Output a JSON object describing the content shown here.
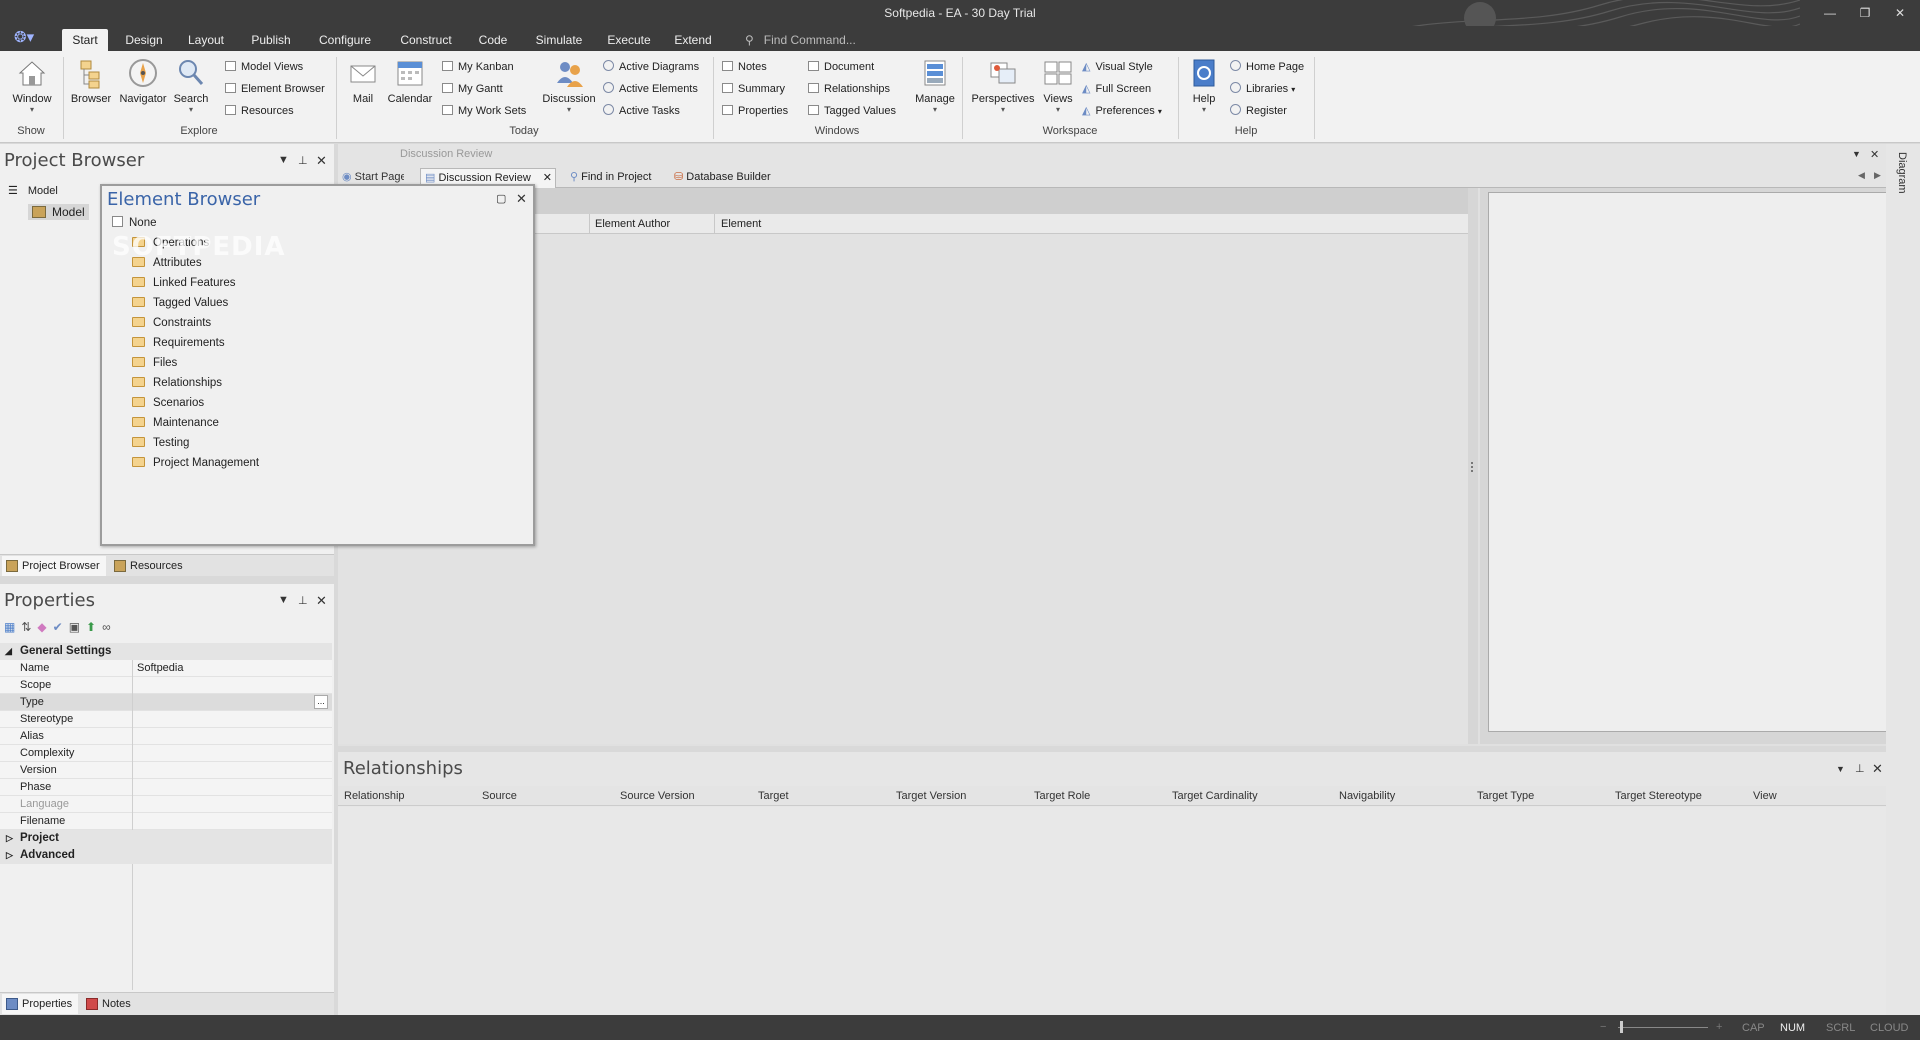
{
  "window": {
    "title": "Softpedia - EA - 30 Day Trial"
  },
  "menu": {
    "tabs": [
      "Start",
      "Design",
      "Layout",
      "Publish",
      "Configure",
      "Construct",
      "Code",
      "Simulate",
      "Execute",
      "Extend"
    ],
    "find_command": "Find Command..."
  },
  "ribbon": {
    "show": {
      "window": "Window",
      "label": "Show"
    },
    "explore": {
      "browser": "Browser",
      "navigator": "Navigator",
      "search": "Search",
      "model_views": "Model Views",
      "element_browser": "Element Browser",
      "resources": "Resources",
      "label": "Explore"
    },
    "today": {
      "mail": "Mail",
      "calendar": "Calendar",
      "my_kanban": "My Kanban",
      "my_gantt": "My Gantt",
      "my_work_sets": "My Work Sets",
      "discussion": "Discussion",
      "active_diagrams": "Active Diagrams",
      "active_elements": "Active Elements",
      "active_tasks": "Active Tasks",
      "label": "Today"
    },
    "windows": {
      "notes": "Notes",
      "summary": "Summary",
      "properties": "Properties",
      "document": "Document",
      "relationships": "Relationships",
      "tagged_values": "Tagged Values",
      "label": "Windows"
    },
    "workspace": {
      "manage": "Manage",
      "perspectives": "Perspectives",
      "views": "Views",
      "visual_style": "Visual Style",
      "full_screen": "Full Screen",
      "preferences": "Preferences",
      "label": "Workspace"
    },
    "help": {
      "help": "Help",
      "home_page": "Home Page",
      "libraries": "Libraries",
      "register": "Register",
      "label": "Help"
    }
  },
  "project_browser": {
    "title": "Project Browser",
    "header": "Model",
    "root": "Model",
    "tabs": [
      "Project Browser",
      "Resources"
    ]
  },
  "element_browser": {
    "title": "Element Browser",
    "none": "None",
    "items": [
      "Operations",
      "Attributes",
      "Linked Features",
      "Tagged Values",
      "Constraints",
      "Requirements",
      "Files",
      "Relationships",
      "Scenarios",
      "Maintenance",
      "Testing",
      "Project Management"
    ],
    "watermark": "SOFTPEDIA"
  },
  "properties": {
    "title": "Properties",
    "section_general": "General Settings",
    "rows": [
      {
        "k": "Name",
        "v": "Softpedia"
      },
      {
        "k": "Scope",
        "v": ""
      },
      {
        "k": "Type",
        "v": ""
      },
      {
        "k": "Stereotype",
        "v": ""
      },
      {
        "k": "Alias",
        "v": ""
      },
      {
        "k": "Complexity",
        "v": ""
      },
      {
        "k": "Version",
        "v": ""
      },
      {
        "k": "Phase",
        "v": ""
      },
      {
        "k": "Language",
        "v": ""
      },
      {
        "k": "Filename",
        "v": ""
      }
    ],
    "section_project": "Project",
    "section_advanced": "Advanced",
    "tabs": [
      "Properties",
      "Notes"
    ]
  },
  "main": {
    "doc_title": "Discussion Review",
    "tabs": [
      "Start Page",
      "Discussion Review",
      "Find in Project",
      "Database Builder"
    ],
    "columns": [
      "Element Author",
      "Element"
    ]
  },
  "side_strip": {
    "diagram": "Diagram"
  },
  "relationships": {
    "title": "Relationships",
    "columns": [
      "Relationship",
      "Source",
      "Source Version",
      "Target",
      "Target Version",
      "Target Role",
      "Target Cardinality",
      "Navigability",
      "Target Type",
      "Target Stereotype",
      "View"
    ]
  },
  "status": {
    "cap": "CAP",
    "num": "NUM",
    "scrl": "SCRL",
    "cloud": "CLOUD"
  }
}
